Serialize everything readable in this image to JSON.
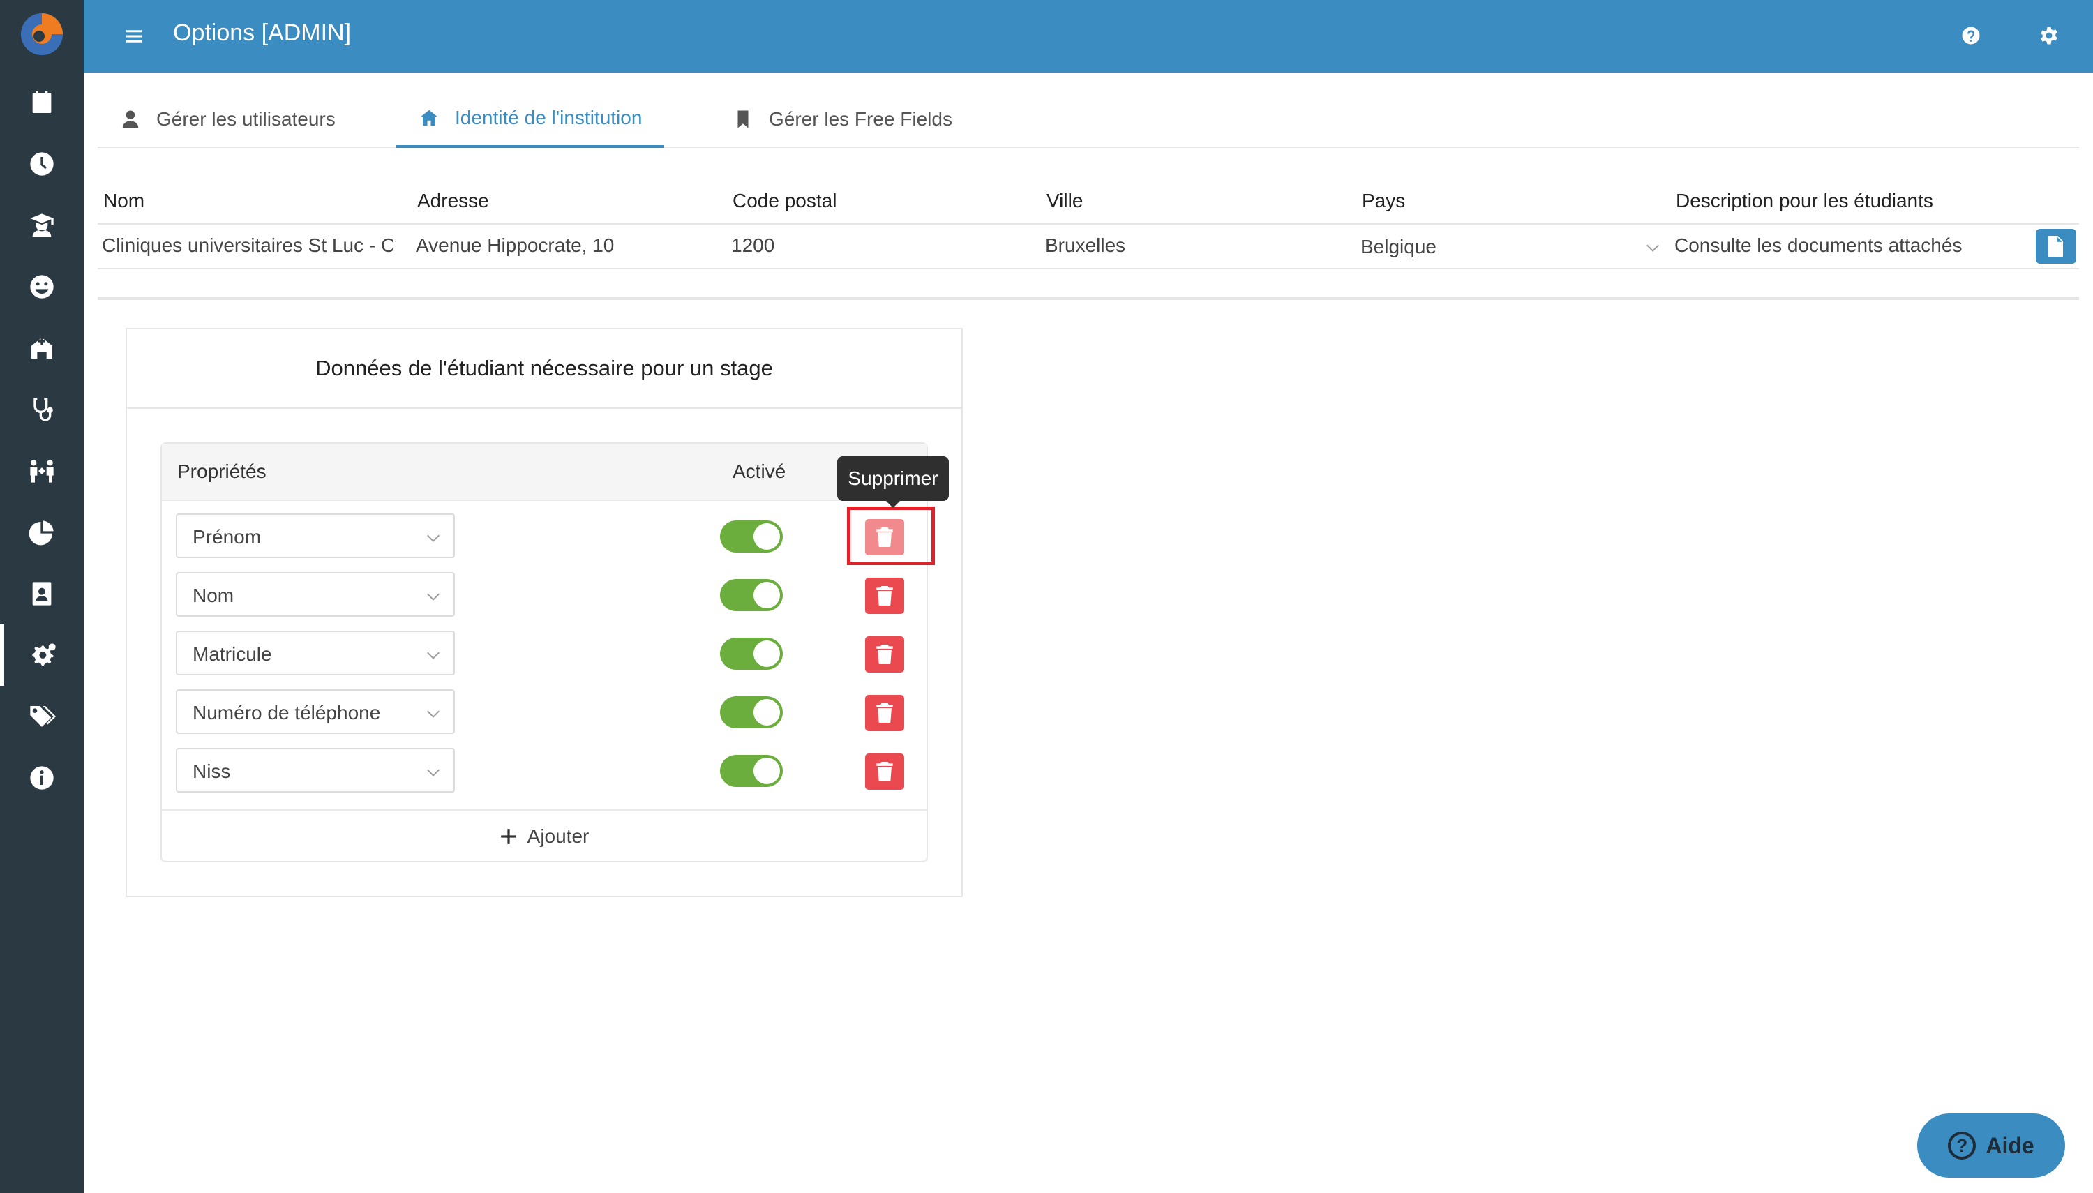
{
  "topbar": {
    "title": "Options [ADMIN]"
  },
  "tabs": [
    {
      "label": "Gérer les utilisateurs"
    },
    {
      "label": "Identité de l'institution"
    },
    {
      "label": "Gérer les Free Fields"
    }
  ],
  "institution": {
    "headers": [
      "Nom",
      "Adresse",
      "Code postal",
      "Ville",
      "Pays",
      "Description pour les étudiants"
    ],
    "row": {
      "nom": "Cliniques universitaires St Luc - Co",
      "adresse": "Avenue Hippocrate, 10",
      "code_postal": "1200",
      "ville": "Bruxelles",
      "pays": "Belgique",
      "description": "Consulte les documents attachés"
    }
  },
  "card": {
    "title": "Données de l'étudiant nécessaire pour un stage",
    "col_properties": "Propriétés",
    "col_active": "Activé",
    "rows": [
      {
        "property": "Prénom",
        "active": true
      },
      {
        "property": "Nom",
        "active": true
      },
      {
        "property": "Matricule",
        "active": true
      },
      {
        "property": "Numéro de téléphone",
        "active": true
      },
      {
        "property": "Niss",
        "active": true
      }
    ],
    "add_label": "Ajouter"
  },
  "tooltip": {
    "text": "Supprimer"
  },
  "help": {
    "label": "Aide"
  },
  "colors": {
    "primary": "#3a8cc1",
    "sidebar": "#2b3a42",
    "toggle_on": "#6cae3e",
    "delete": "#ea4a4f",
    "highlight": "#e0232a"
  }
}
